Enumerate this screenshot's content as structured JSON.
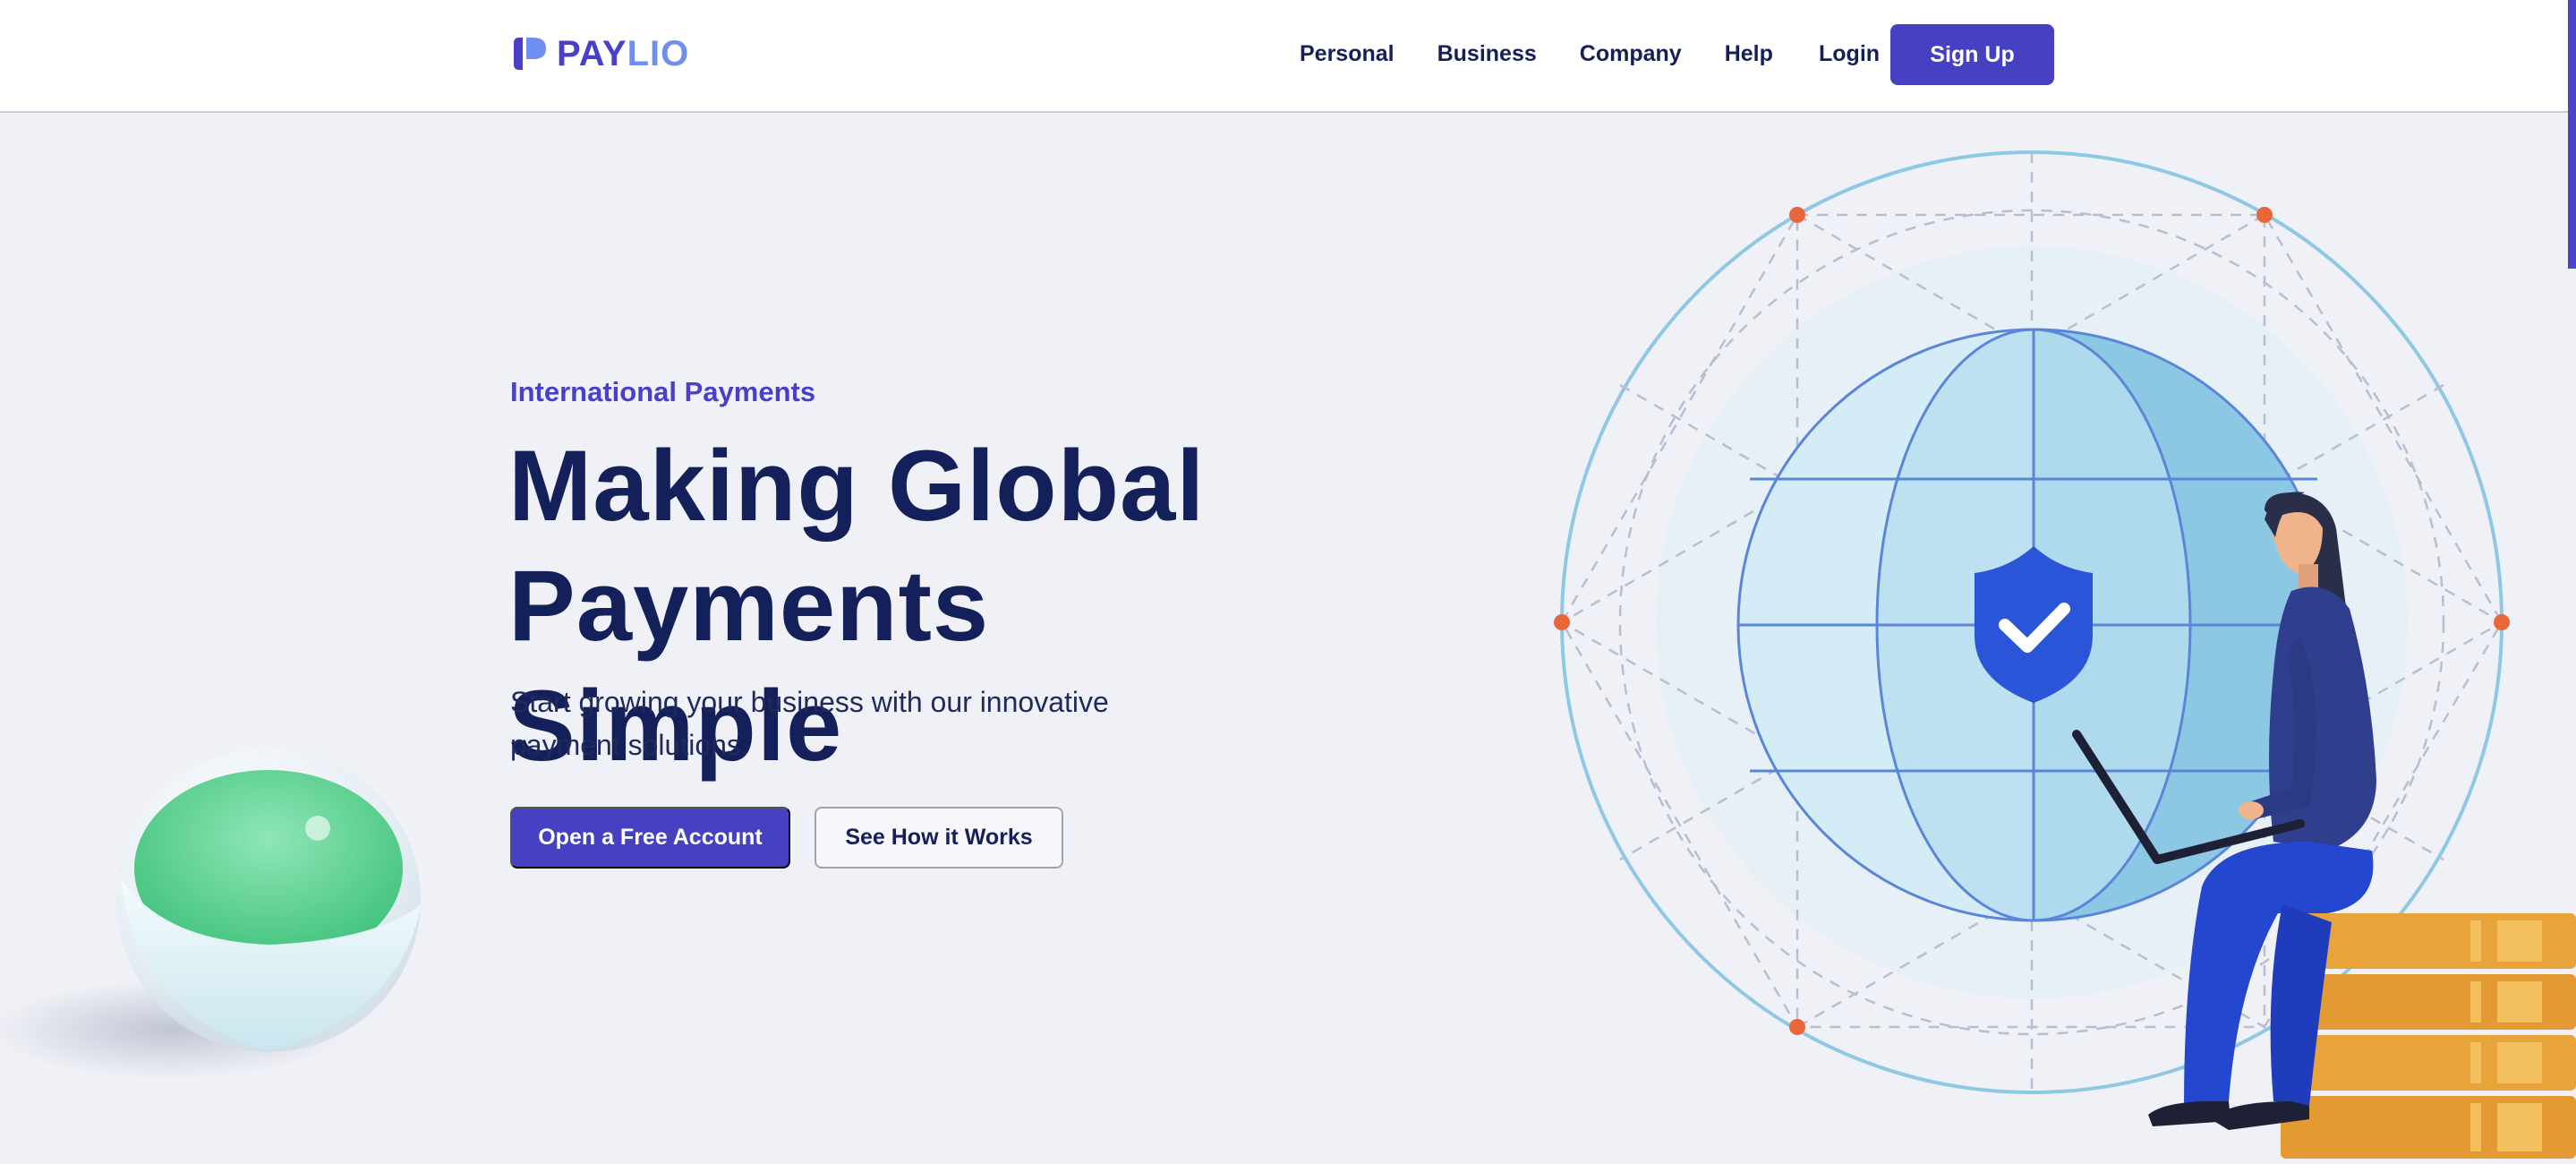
{
  "brand": {
    "name_part1": "PAY",
    "name_part2": "LIO"
  },
  "nav": {
    "items": [
      {
        "label": "Personal"
      },
      {
        "label": "Business"
      },
      {
        "label": "Company"
      },
      {
        "label": "Help"
      }
    ],
    "login_label": "Login",
    "signup_label": "Sign Up"
  },
  "hero": {
    "eyebrow": "International Payments",
    "headline_line1": "Making Global",
    "headline_line2": "Payments Simple",
    "subtext": "Start growing your business with our innovative payment solutions.",
    "primary_cta": "Open a Free Account",
    "secondary_cta": "See How it Works"
  },
  "icons": {
    "logo": "paylio-logo-icon",
    "shield": "shield-check-icon",
    "globe": "globe-icon"
  },
  "colors": {
    "primary": "#4640c2",
    "heading": "#14205a",
    "accent": "#6e8ef0",
    "background": "#f0f1f7",
    "node": "#e8663a",
    "shield": "#2a55d8",
    "orb_green": "#5ad38f"
  }
}
